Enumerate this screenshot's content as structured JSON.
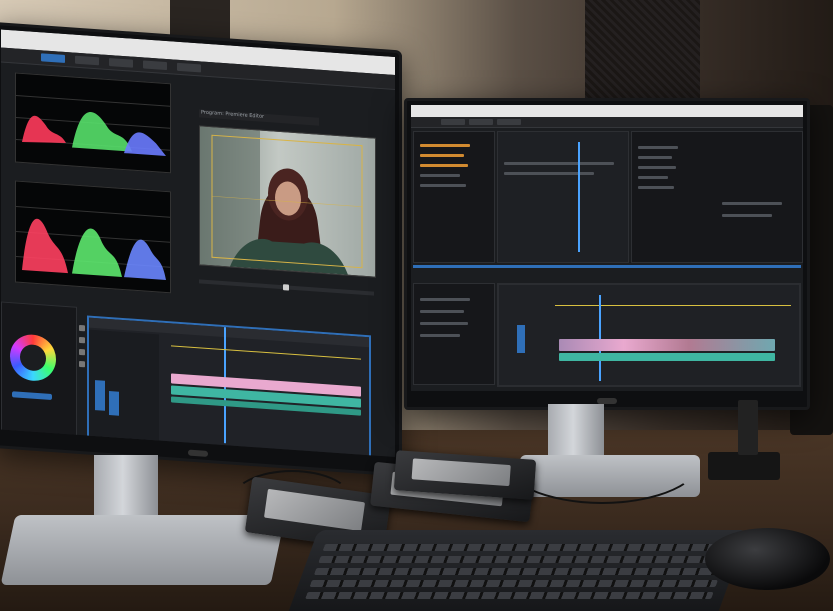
{
  "scene": {
    "description_free": true
  },
  "left_monitor": {
    "program_tab_label": "Program: Premiere Editor"
  },
  "icons": {
    "color_wheel": "color-wheel-icon",
    "play": "play-icon",
    "monitor_logo": "monitor-logo-icon"
  },
  "colors": {
    "timeline_accent": "#2f6fb8",
    "clip_pink": "#e9a9cf",
    "clip_teal": "#3fb6a2",
    "playhead": "#4aa3ff",
    "ui_dark": "#1b1d20"
  }
}
